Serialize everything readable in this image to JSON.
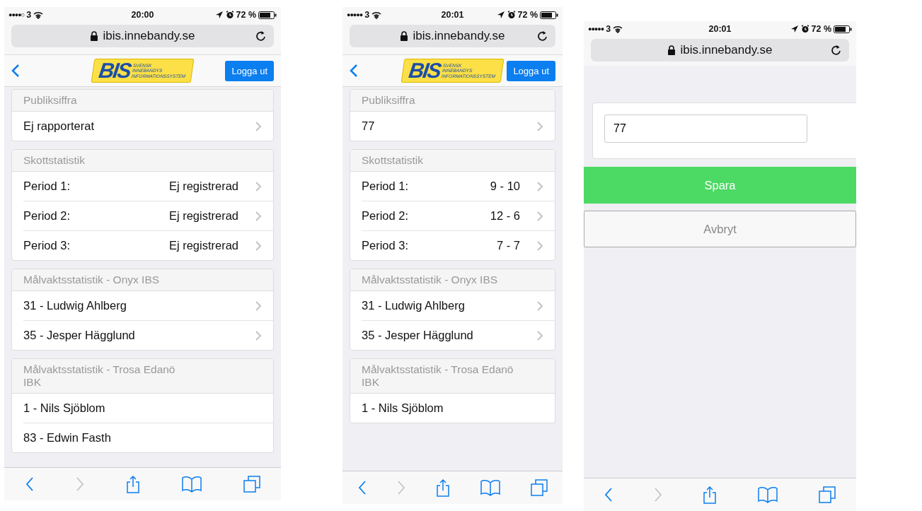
{
  "screens": [
    {
      "status_bar": {
        "signal": "●●●●○",
        "carrier": "3",
        "time": "20:00",
        "battery": "72 %"
      },
      "url": "ibis.innebandy.se",
      "nav": {
        "logo_mark": "BIS",
        "logo_lines": [
          "SVENSK",
          "INNEBANDYS",
          "INFORMATIONSSYSTEM"
        ],
        "logout": "Logga ut"
      },
      "sections": [
        {
          "title": "Publiksiffra",
          "rows": [
            {
              "label": "Ej rapporterat",
              "value": "",
              "chevron": true
            }
          ]
        },
        {
          "title": "Skottstatistik",
          "rows": [
            {
              "label": "Period 1:",
              "value": "Ej registrerad",
              "chevron": true
            },
            {
              "label": "Period 2:",
              "value": "Ej registrerad",
              "chevron": true
            },
            {
              "label": "Period 3:",
              "value": "Ej registrerad",
              "chevron": true
            }
          ]
        },
        {
          "title": "Målvaktsstatistik - Onyx IBS",
          "rows": [
            {
              "label": "31 - Ludwig Ahlberg",
              "value": "",
              "chevron": true
            },
            {
              "label": "35 - Jesper Hägglund",
              "value": "",
              "chevron": true
            }
          ]
        },
        {
          "title": "Målvaktsstatistik - Trosa Edanö IBK",
          "rows": [
            {
              "label": "1 - Nils Sjöblom",
              "value": "",
              "chevron": false
            },
            {
              "label": "83 - Edwin Fasth",
              "value": "",
              "chevron": false
            }
          ]
        }
      ],
      "toolbar": {
        "back_enabled": true,
        "forward_enabled": false
      }
    },
    {
      "status_bar": {
        "signal": "●●●●●",
        "carrier": "3",
        "time": "20:01",
        "battery": "72 %"
      },
      "url": "ibis.innebandy.se",
      "nav": {
        "logo_mark": "BIS",
        "logo_lines": [
          "SVENSK",
          "INNEBANDYS",
          "INFORMATIONSSYSTEM"
        ],
        "logout": "Logga ut"
      },
      "sections": [
        {
          "title": "Publiksiffra",
          "rows": [
            {
              "label": "77",
              "value": "",
              "chevron": true
            }
          ]
        },
        {
          "title": "Skottstatistik",
          "rows": [
            {
              "label": "Period 1:",
              "value": "9 - 10",
              "chevron": true
            },
            {
              "label": "Period 2:",
              "value": "12 - 6",
              "chevron": true
            },
            {
              "label": "Period 3:",
              "value": "7 - 7",
              "chevron": true
            }
          ]
        },
        {
          "title": "Målvaktsstatistik - Onyx IBS",
          "rows": [
            {
              "label": "31 - Ludwig Ahlberg",
              "value": "",
              "chevron": true
            },
            {
              "label": "35 - Jesper Hägglund",
              "value": "",
              "chevron": true
            }
          ]
        },
        {
          "title": "Målvaktsstatistik - Trosa Edanö IBK",
          "rows": [
            {
              "label": "1 - Nils Sjöblom",
              "value": "",
              "chevron": false
            }
          ]
        }
      ],
      "toolbar": {
        "back_enabled": true,
        "forward_enabled": false
      }
    },
    {
      "status_bar": {
        "signal": "●●●●●",
        "carrier": "3",
        "time": "20:01",
        "battery": "72 %"
      },
      "url": "ibis.innebandy.se",
      "form": {
        "value": "77",
        "save": "Spara",
        "cancel": "Avbryt"
      },
      "toolbar": {
        "back_enabled": true,
        "forward_enabled": false
      }
    }
  ]
}
